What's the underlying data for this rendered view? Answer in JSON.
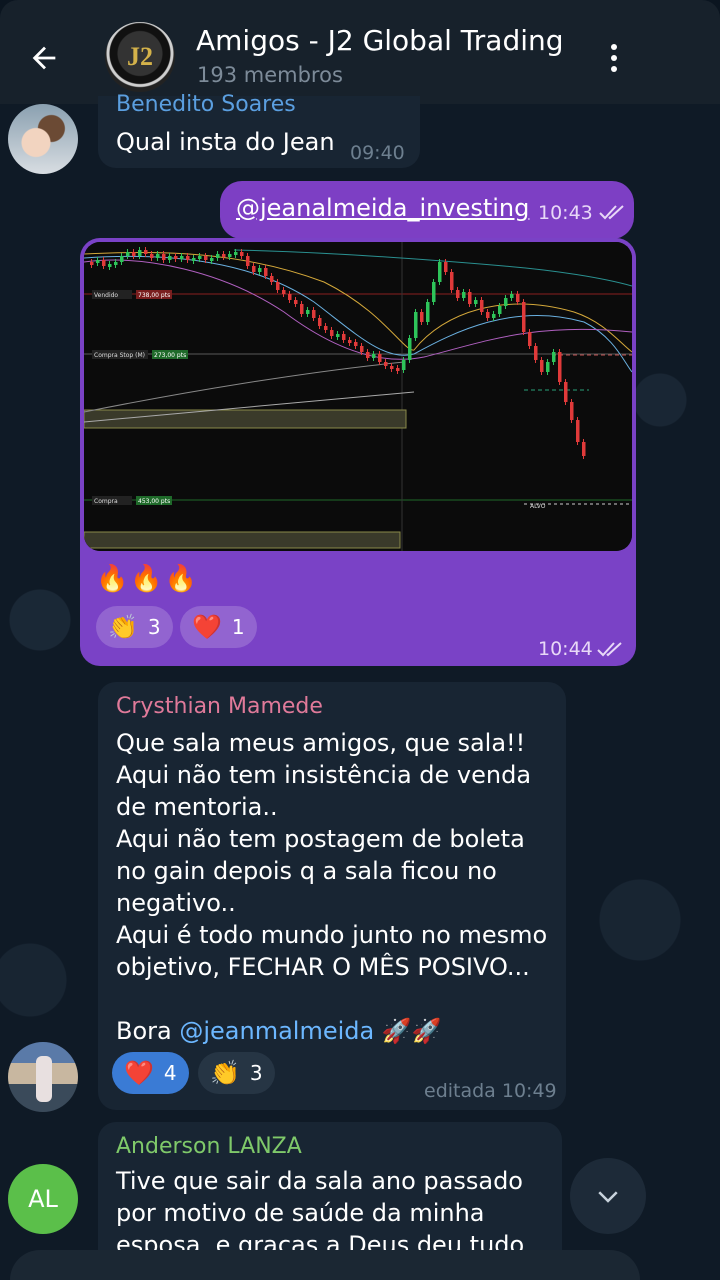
{
  "header": {
    "title": "Amigos - J2 Global Trading",
    "members": "193 membros",
    "avatar_text": "J2"
  },
  "messages": [
    {
      "sender": "Benedito Soares",
      "text": "Qual insta do Jean",
      "time": "09:40"
    },
    {
      "link": "@jeanalmeida_investing",
      "time": "10:43"
    },
    {
      "emoji": "🔥🔥🔥",
      "reactions": [
        {
          "emoji": "👏",
          "count": "3"
        },
        {
          "emoji": "❤️",
          "count": "1"
        }
      ],
      "time": "10:44"
    },
    {
      "sender": "Crysthian Mamede",
      "lines": [
        "Que sala meus amigos, que sala!!",
        "Aqui não tem insistência de venda",
        "de mentoria..",
        "Aqui não tem postagem de boleta",
        "no gain depois q a sala ficou no",
        "negativo..",
        "Aqui é todo mundo junto no mesmo",
        "objetivo, FECHAR O MÊS POSIVO..."
      ],
      "last_prefix": "Bora ",
      "mention": "@jeanmalmeida",
      "last_suffix": " 🚀🚀",
      "reactions": [
        {
          "emoji": "❤️",
          "count": "4"
        },
        {
          "emoji": "👏",
          "count": "3"
        }
      ],
      "time": "editada 10:49"
    },
    {
      "sender": "Anderson LANZA",
      "avatar_initials": "AL",
      "lines": [
        "Tive que sair da sala ano passado",
        "por motivo de saúde da minha",
        "esposa, e graças a Deus deu tudo"
      ]
    }
  ],
  "chart_labels": {
    "vendido": "Vendido",
    "vendido_val": "738,00 pts",
    "compra_stop": "Compra Stop (M)",
    "compra_stop_val": "273,00 pts",
    "compra": "Compra",
    "compra_val": "453,00 pts",
    "alvo": "ALVO"
  },
  "colors": {
    "bubble_out": "#7a42c6",
    "bubble_in": "#182533",
    "header": "#17212b"
  }
}
